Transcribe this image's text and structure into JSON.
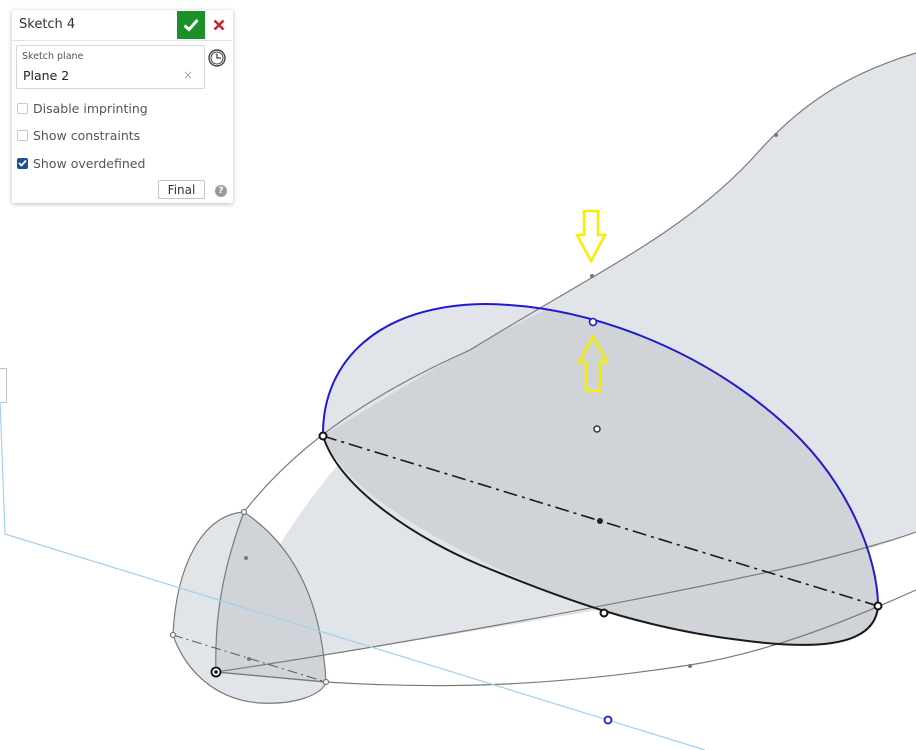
{
  "sketch_panel": {
    "title": "Sketch 4",
    "accept_icon": "check-icon",
    "cancel_icon": "close-icon",
    "sketch_plane": {
      "label": "Sketch plane",
      "value": "Plane 2",
      "clear_icon": "×"
    },
    "history_icon": "clock-icon",
    "options": [
      {
        "label": "Disable imprinting",
        "checked": false
      },
      {
        "label": "Show constraints",
        "checked": false
      },
      {
        "label": "Show overdefined",
        "checked": true
      }
    ],
    "final_button": "Final",
    "help_icon": "?"
  },
  "viewport": {
    "colors": {
      "surface_light": "#e1e4e8",
      "surface_dark": "#d0d3d8",
      "edge": "#7a7a7a",
      "selected_curve": "#1c1ccf",
      "sketch_curve": "#1a1a1a",
      "plane_edge": "#9fd2ec",
      "annotation_arrow": "#f5f000"
    },
    "annotations": [
      {
        "type": "arrow-down",
        "meaning": "points to loft edge point"
      },
      {
        "type": "arrow-up",
        "meaning": "points to selected sketch curve point"
      }
    ]
  }
}
